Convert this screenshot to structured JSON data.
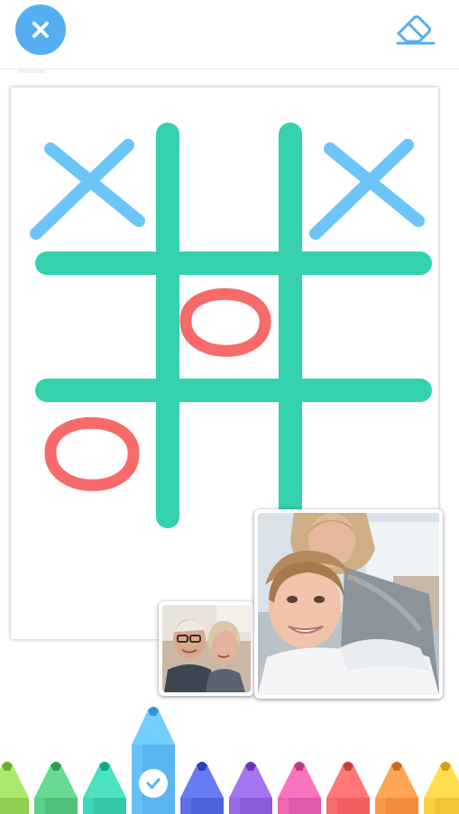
{
  "header": {
    "close_icon": "close-icon",
    "eraser_icon": "eraser-icon"
  },
  "board": {
    "grid_color": "#33d1ad",
    "x_color": "#6dc4f8",
    "o_color": "#f76a6a",
    "cells": [
      [
        "X",
        "",
        "X"
      ],
      [
        "",
        "O",
        ""
      ],
      [
        "O",
        "",
        ""
      ]
    ]
  },
  "video_call": {
    "participants": [
      {
        "role": "self-view",
        "description_icon": "grandparents-video"
      },
      {
        "role": "remote-view",
        "description_icon": "mother-and-child-video"
      }
    ]
  },
  "palette": {
    "selected_index": 3,
    "colors": [
      {
        "name": "lime",
        "hex": "#8fcf52"
      },
      {
        "name": "green",
        "hex": "#4fc27a"
      },
      {
        "name": "teal",
        "hex": "#33c9a8"
      },
      {
        "name": "sky-blue",
        "hex": "#5ab4ee"
      },
      {
        "name": "indigo",
        "hex": "#4e63d9"
      },
      {
        "name": "purple",
        "hex": "#8c5bd8"
      },
      {
        "name": "magenta",
        "hex": "#e05ba6"
      },
      {
        "name": "red",
        "hex": "#f25e5e"
      },
      {
        "name": "orange",
        "hex": "#f28c3c"
      },
      {
        "name": "yellow",
        "hex": "#f4c437"
      }
    ]
  }
}
